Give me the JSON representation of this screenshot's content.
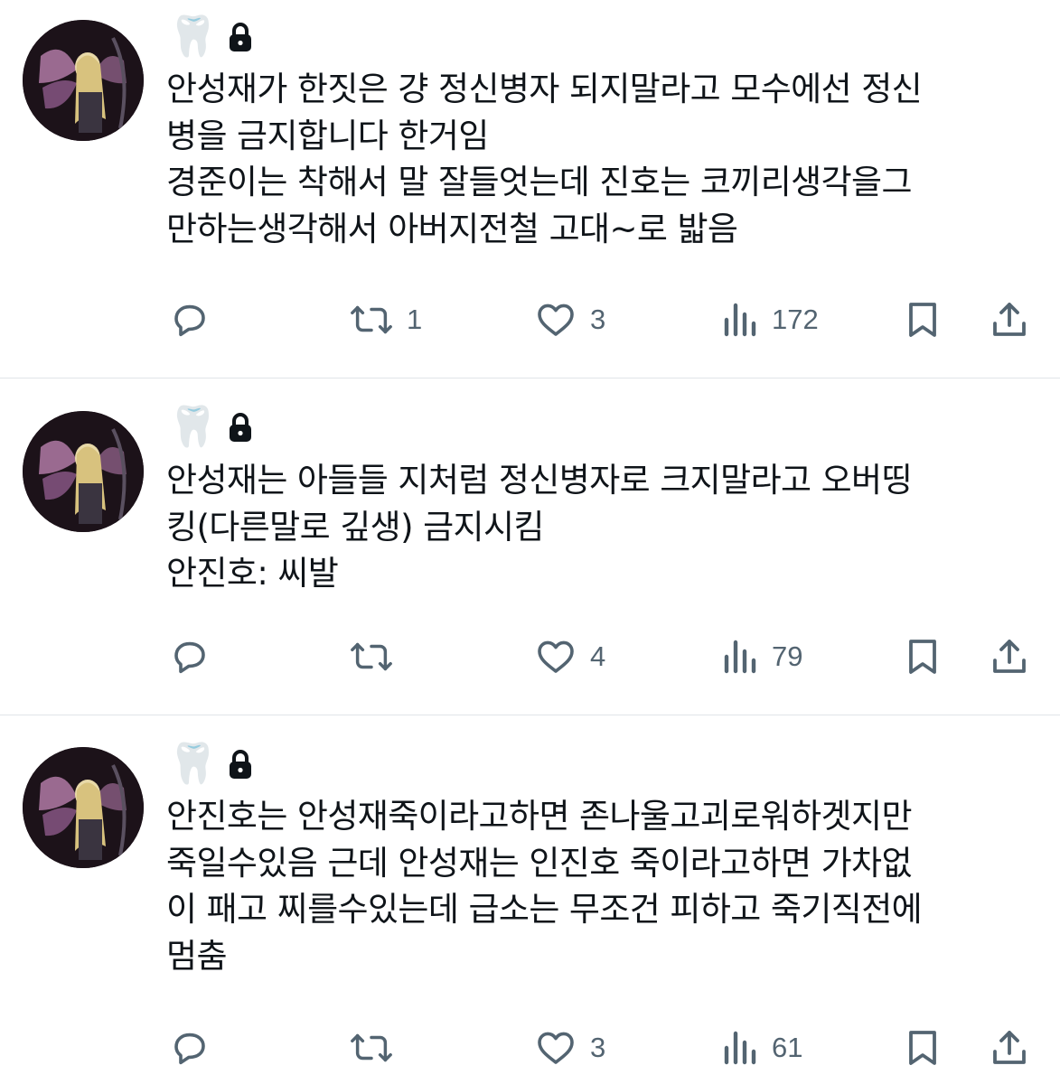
{
  "posts": [
    {
      "author": {
        "display_name": "🦷"
      },
      "text": "안성재가 한짓은 걍 정신병자 되지말라고 모수에선 정신\n병을 금지합니다 한거임\n경준이는 착해서 말 잘들엇는데 진호는 코끼리생각을그\n만하는생각해서 아버지전철 고대~로 밟음",
      "stats": {
        "replies": "",
        "reposts": "1",
        "likes": "3",
        "views": "172"
      }
    },
    {
      "author": {
        "display_name": "🦷"
      },
      "text": "안성재는 아들들 지처럼 정신병자로 크지말라고 오버띵\n킹(다른말로 깊생) 금지시킴\n안진호: 씨발",
      "stats": {
        "replies": "",
        "reposts": "",
        "likes": "4",
        "views": "79"
      }
    },
    {
      "author": {
        "display_name": "🦷"
      },
      "text": "안진호는 안성재죽이라고하면 존나울고괴로워하겟지만\n죽일수있음 근데 안성재는 인진호 죽이라고하면 가차없\n이 패고 찌를수있는데 급소는 무조건 피하고 죽기직전에\n멈춤",
      "stats": {
        "replies": "",
        "reposts": "",
        "likes": "3",
        "views": "61"
      }
    }
  ],
  "icons": {
    "reply": "speech-bubble-icon",
    "repost": "repost-arrows-icon",
    "like": "heart-icon",
    "views": "bar-chart-icon",
    "bookmark": "bookmark-icon",
    "share": "share-upload-icon",
    "protected": "lock-icon"
  },
  "colors": {
    "action_gray": "#536471",
    "text": "#0f1419",
    "divider": "#e1e5e8"
  }
}
